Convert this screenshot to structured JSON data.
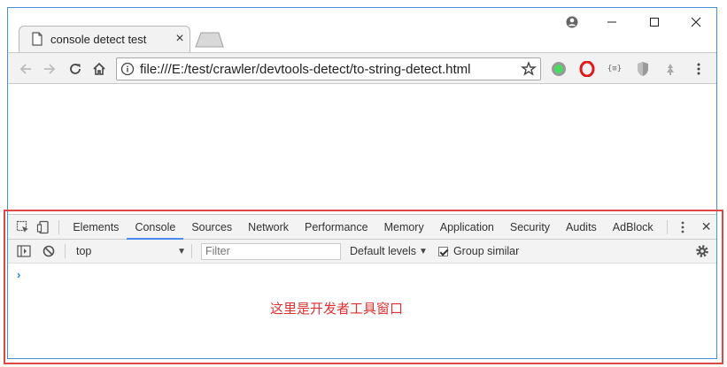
{
  "tab": {
    "title": "console detect test",
    "close": "×"
  },
  "omnibox": {
    "url": "file:///E:/test/crawler/devtools-detect/to-string-detect.html"
  },
  "devtools": {
    "tabs": [
      "Elements",
      "Console",
      "Sources",
      "Network",
      "Performance",
      "Memory",
      "Application",
      "Security",
      "Audits",
      "AdBlock"
    ],
    "active_tab": "Console",
    "context": "top",
    "filter_placeholder": "Filter",
    "levels": "Default levels",
    "group_similar": "Group similar",
    "prompt": "›",
    "close": "✕"
  },
  "annotation": "这里是开发者工具窗口",
  "colors": {
    "accent": "#4a8af4",
    "annotation": "#e03030",
    "highlight_box": "#e04646"
  }
}
